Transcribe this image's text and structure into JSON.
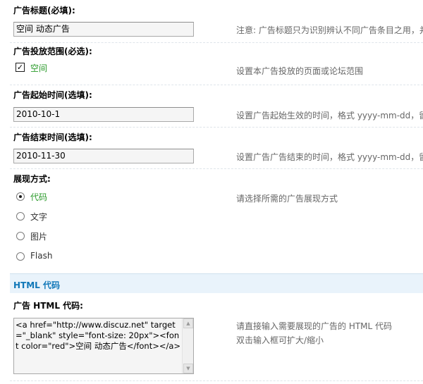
{
  "fields": {
    "title": {
      "label": "广告标题(必填):",
      "value": "空间 动态广告",
      "hint": "注意: 广告标题只为识别辨认不同广告条目之用，并"
    },
    "scope": {
      "label": "广告投放范围(必选):",
      "option": "空间",
      "checked": true,
      "hint": "设置本广告投放的页面或论坛范围"
    },
    "start_time": {
      "label": "广告起始时间(选填):",
      "value": "2010-10-1",
      "hint": "设置广告起始生效的时间，格式 yyyy-mm-dd，留"
    },
    "end_time": {
      "label": "广告结束时间(选填):",
      "value": "2010-11-30",
      "hint": "设置广告广告结束的时间，格式 yyyy-mm-dd，留"
    },
    "display_mode": {
      "label": "展现方式:",
      "hint": "请选择所需的广告展现方式",
      "options": [
        "代码",
        "文字",
        "图片",
        "Flash"
      ],
      "selected": "代码"
    }
  },
  "html_section": {
    "title": "HTML 代码",
    "code_label": "广告  HTML 代码:",
    "code_value": "<a href=\"http://www.discuz.net\" target=\"_blank\" style=\"font-size: 20px\"><font color=\"red\">空间 动态广告</font></a>",
    "hint_line1": "请直接输入需要展现的广告的 HTML 代码",
    "hint_line2": "双击输入框可扩大/缩小"
  },
  "icons": {
    "scroll_up": "triangle-up",
    "scroll_down": "triangle-down",
    "check": "checkmark"
  }
}
